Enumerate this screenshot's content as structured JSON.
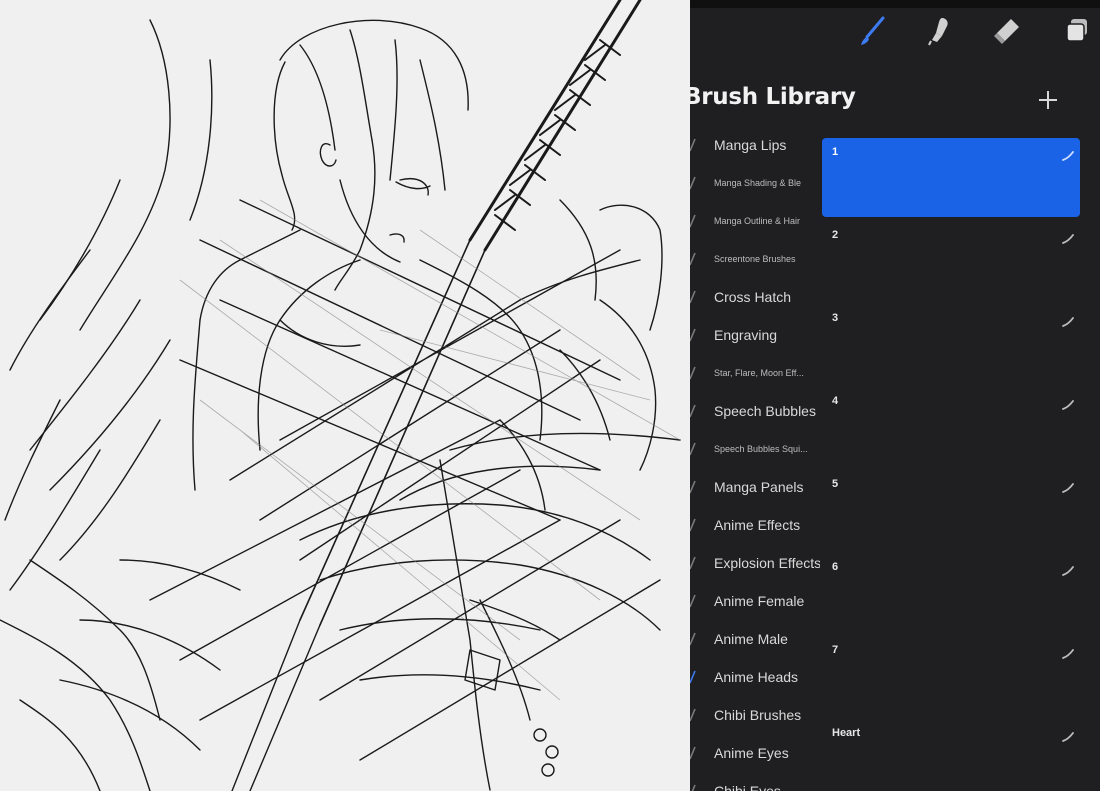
{
  "panel": {
    "title": "Brush Library",
    "tools": [
      {
        "name": "brush-tool",
        "icon": "paintbrush-icon",
        "active": true
      },
      {
        "name": "smudge-tool",
        "icon": "smudge-icon",
        "active": false
      },
      {
        "name": "eraser-tool",
        "icon": "eraser-icon",
        "active": false
      },
      {
        "name": "layers-tool",
        "icon": "layers-icon",
        "active": false
      }
    ],
    "add_icon": "plus-icon",
    "accent_color": "#1a63e6"
  },
  "brush_sets": [
    {
      "label": "Manga Lips",
      "size": "big"
    },
    {
      "label": "Manga Shading & Ble",
      "size": "small"
    },
    {
      "label": "Manga Outline & Hair",
      "size": "small"
    },
    {
      "label": "Screentone Brushes",
      "size": "small"
    },
    {
      "label": "Cross Hatch",
      "size": "big"
    },
    {
      "label": "Engraving",
      "size": "big"
    },
    {
      "label": "Star, Flare, Moon Eff...",
      "size": "small"
    },
    {
      "label": "Speech Bubbles",
      "size": "big"
    },
    {
      "label": "Speech Bubbles Squi...",
      "size": "small"
    },
    {
      "label": "Manga Panels",
      "size": "big"
    },
    {
      "label": "Anime Effects",
      "size": "big"
    },
    {
      "label": "Explosion Effects",
      "size": "big"
    },
    {
      "label": "Anime Female",
      "size": "big"
    },
    {
      "label": "Anime Male",
      "size": "big"
    },
    {
      "label": "Anime Heads",
      "size": "big"
    },
    {
      "label": "Chibi Brushes",
      "size": "big"
    },
    {
      "label": "Anime Eyes",
      "size": "big"
    },
    {
      "label": "Chibi Eyes",
      "size": "big"
    }
  ],
  "brushes": [
    {
      "name": "1",
      "selected": true
    },
    {
      "name": "2",
      "selected": false
    },
    {
      "name": "3",
      "selected": false
    },
    {
      "name": "4",
      "selected": false
    },
    {
      "name": "5",
      "selected": false
    },
    {
      "name": "6",
      "selected": false
    },
    {
      "name": "7",
      "selected": false
    },
    {
      "name": "Heart",
      "selected": false
    }
  ]
}
